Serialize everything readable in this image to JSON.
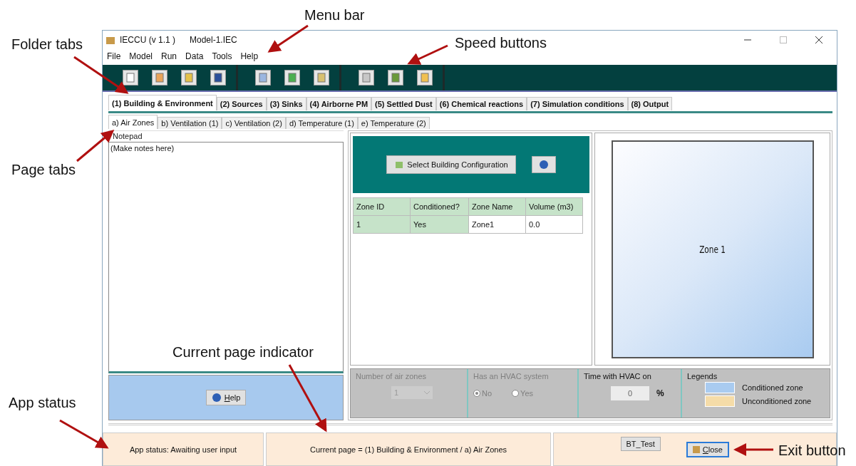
{
  "annotations": [
    {
      "text": "Menu bar"
    },
    {
      "text": "Folder tabs"
    },
    {
      "text": "Speed buttons"
    },
    {
      "text": "Page tabs"
    },
    {
      "text": "Current page indicator"
    },
    {
      "text": "App status"
    },
    {
      "text": "Exit button"
    }
  ],
  "window": {
    "title": "IECCU (v 1.1 )",
    "file": "Model-1.IEC"
  },
  "menu": [
    "File",
    "Model",
    "Run",
    "Data",
    "Tools",
    "Help"
  ],
  "folder_tabs": [
    {
      "label": "(1) Building & Environment",
      "selected": true
    },
    {
      "label": "(2) Sources",
      "selected": false
    },
    {
      "label": "(3) Sinks",
      "selected": false
    },
    {
      "label": "(4) Airborne PM",
      "selected": false
    },
    {
      "label": "(5) Settled Dust",
      "selected": false
    },
    {
      "label": "(6) Chemical reactions",
      "selected": false
    },
    {
      "label": "(7) Simulation conditions",
      "selected": false
    },
    {
      "label": "(8) Output",
      "selected": false
    }
  ],
  "page_tabs": [
    {
      "label": "a) Air Zones",
      "selected": true
    },
    {
      "label": "b) Ventilation (1)",
      "selected": false
    },
    {
      "label": "c) Ventilation (2)",
      "selected": false
    },
    {
      "label": "d) Temperature (1)",
      "selected": false
    },
    {
      "label": "e) Temperature (2)",
      "selected": false
    }
  ],
  "notepad": {
    "label": "Notepad",
    "value": "(Make notes here)"
  },
  "help_button": "Help",
  "config_button": "Select Building Configuration",
  "zone_table": {
    "columns": [
      "Zone ID",
      "Conditioned?",
      "Zone Name",
      "Volume (m3)"
    ],
    "rows": [
      [
        "1",
        "Yes",
        "Zone1",
        "0.0"
      ]
    ]
  },
  "preview": {
    "zone_label": "Zone 1"
  },
  "settings": {
    "zones": {
      "label": "Number of air zones",
      "value": "1",
      "disabled": true
    },
    "hvac": {
      "label": "Has an HVAC system",
      "disabled": true,
      "options": [
        {
          "label": "No",
          "selected": true
        },
        {
          "label": "Yes",
          "selected": false
        }
      ]
    },
    "time": {
      "label": "Time with HVAC on",
      "value": "0",
      "unit": "%"
    },
    "legends": {
      "label": "Legends",
      "items": [
        {
          "label": "Conditioned zone",
          "color": "#a9cbf0"
        },
        {
          "label": "Unconditioned zone",
          "color": "#f5dca8"
        }
      ]
    }
  },
  "status_bar": {
    "app_status": "App status: Awaiting user input",
    "current_page": "Current page = (1) Building & Environment / a) Air Zones",
    "test_button": "BT_Test",
    "close_button": "Close"
  }
}
